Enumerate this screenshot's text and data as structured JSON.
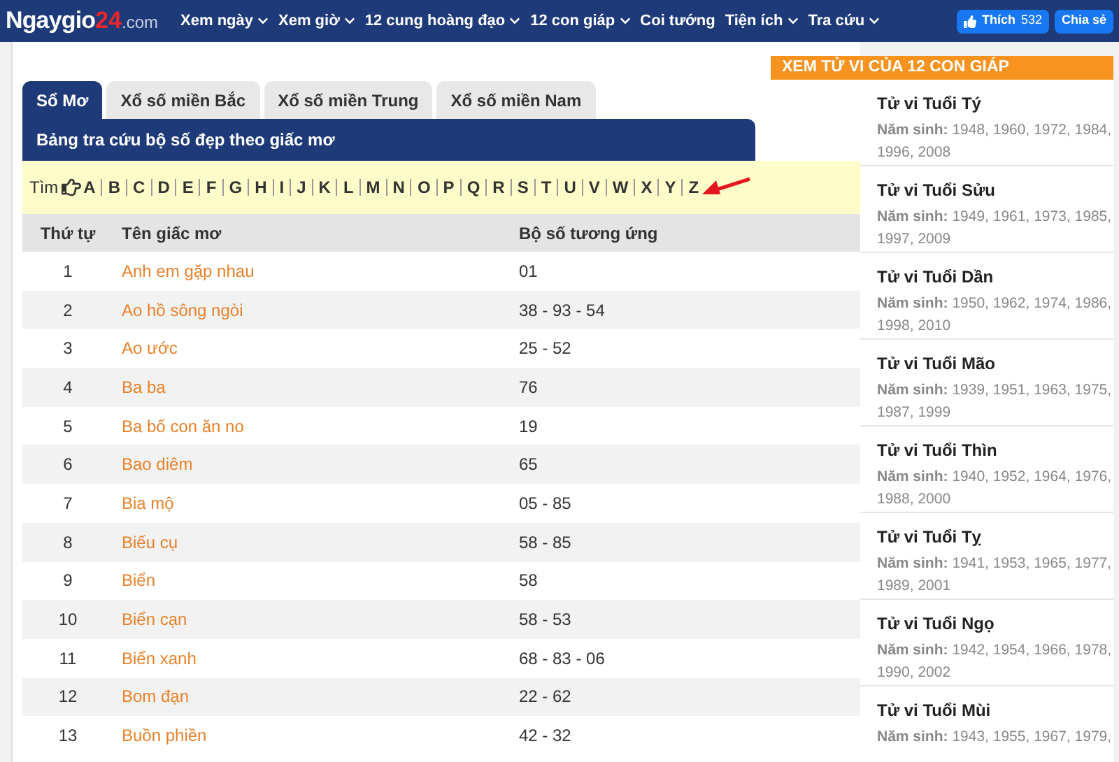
{
  "header": {
    "logo": {
      "name": "Ngaygio",
      "number": "24",
      "domain": ".com"
    },
    "menu": [
      {
        "label": "Xem ngày",
        "dropdown": true
      },
      {
        "label": "Xem giờ",
        "dropdown": true
      },
      {
        "label": "12 cung hoàng đạo",
        "dropdown": true
      },
      {
        "label": "12 con giáp",
        "dropdown": true
      },
      {
        "label": "Coi tướng",
        "dropdown": false
      },
      {
        "label": "Tiện ích",
        "dropdown": true
      },
      {
        "label": "Tra cứu",
        "dropdown": true
      }
    ],
    "like_button": {
      "label": "Thích",
      "count": "532"
    },
    "share_button": "Chia sẻ"
  },
  "tabs": [
    {
      "label": "Sổ Mơ",
      "selected": true
    },
    {
      "label": "Xổ số miền Bắc",
      "selected": false
    },
    {
      "label": "Xổ số miền Trung",
      "selected": false
    },
    {
      "label": "Xổ số miền Nam",
      "selected": false
    }
  ],
  "panel_title": "Bảng tra cứu bộ số đẹp theo giấc mơ",
  "letter_search": {
    "label": "Tìm",
    "letters": [
      "A",
      "B",
      "C",
      "D",
      "E",
      "F",
      "G",
      "H",
      "I",
      "J",
      "K",
      "L",
      "M",
      "N",
      "O",
      "P",
      "Q",
      "R",
      "S",
      "T",
      "U",
      "V",
      "W",
      "X",
      "Y",
      "Z"
    ]
  },
  "table": {
    "columns": [
      "Thứ tự",
      "Tên giấc mơ",
      "Bộ số tương ứng"
    ],
    "rows": [
      [
        "1",
        "Anh em gặp nhau",
        "01"
      ],
      [
        "2",
        "Ao hồ sông ngòi",
        "38 - 93 - 54"
      ],
      [
        "3",
        "Ao ước",
        "25 - 52"
      ],
      [
        "4",
        "Ba ba",
        "76"
      ],
      [
        "5",
        "Ba bố con ăn no",
        "19"
      ],
      [
        "6",
        "Bao diêm",
        "65"
      ],
      [
        "7",
        "Bia mộ",
        "05 - 85"
      ],
      [
        "8",
        "Biếu cụ",
        "58 - 85"
      ],
      [
        "9",
        "Biển",
        "58"
      ],
      [
        "10",
        "Biển cạn",
        "58 - 53"
      ],
      [
        "11",
        "Biển xanh",
        "68 - 83 - 06"
      ],
      [
        "12",
        "Bom đạn",
        "22 - 62"
      ],
      [
        "13",
        "Buồn phiền",
        "42 - 32"
      ]
    ]
  },
  "sidebar": {
    "title": "XEM TỬ VI CỦA 12 CON GIÁP",
    "items": [
      {
        "title": "Tử vi Tuổi Tý",
        "year_label": "Năm sinh:",
        "years": [
          "1948, 1960, 1972, 1984,",
          "1996, 2008"
        ]
      },
      {
        "title": "Tử vi Tuổi Sửu",
        "year_label": "Năm sinh:",
        "years": [
          "1949, 1961, 1973, 1985,",
          "1997, 2009"
        ]
      },
      {
        "title": "Tử vi Tuổi Dần",
        "year_label": "Năm sinh:",
        "years": [
          "1950, 1962, 1974, 1986,",
          "1998, 2010"
        ]
      },
      {
        "title": "Tử vi Tuổi Mão",
        "year_label": "Năm sinh:",
        "years": [
          "1939, 1951, 1963, 1975,",
          "1987, 1999"
        ]
      },
      {
        "title": "Tử vi Tuổi Thìn",
        "year_label": "Năm sinh:",
        "years": [
          "1940, 1952, 1964, 1976,",
          "1988, 2000"
        ]
      },
      {
        "title": "Tử vi Tuổi Tỵ",
        "year_label": "Năm sinh:",
        "years": [
          "1941, 1953, 1965, 1977,",
          "1989, 2001"
        ]
      },
      {
        "title": "Tử vi Tuổi Ngọ",
        "year_label": "Năm sinh:",
        "years": [
          "1942, 1954, 1966, 1978,",
          "1990, 2002"
        ]
      },
      {
        "title": "Tử vi Tuổi Mùi",
        "year_label": "Năm sinh:",
        "years": [
          "1943, 1955, 1967, 1979,"
        ]
      }
    ]
  }
}
